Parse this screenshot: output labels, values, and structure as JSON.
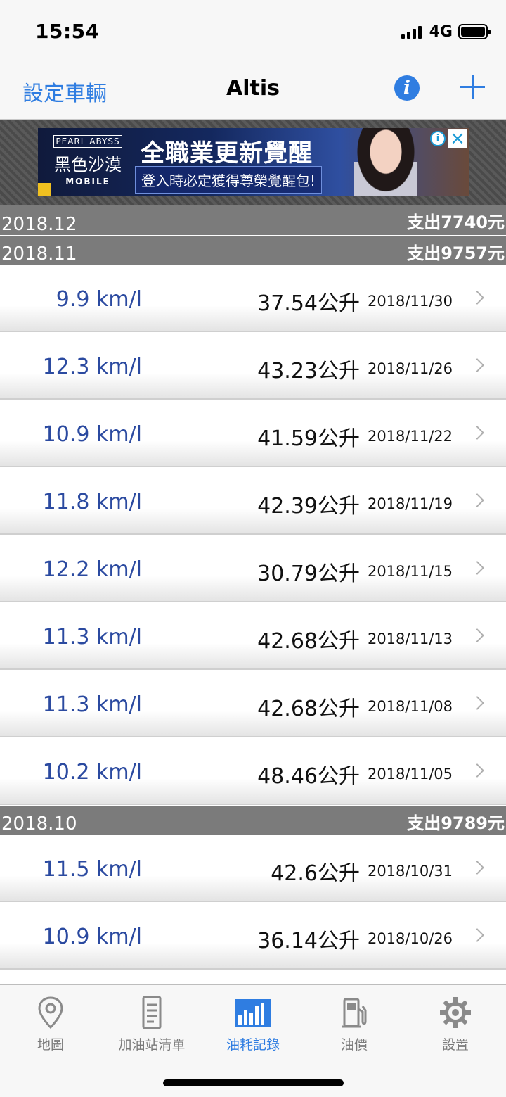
{
  "status_bar": {
    "time": "15:54",
    "network": "4G"
  },
  "nav": {
    "left_label": "設定車輛",
    "title": "Altis",
    "info_icon": "i"
  },
  "ad": {
    "brand": "PEARL ABYSS",
    "game": "黑色沙漠",
    "platform": "MOBILE",
    "headline": "全職業更新覺醒",
    "subline": "登入時必定獲得尊榮覺醒包!",
    "info_icon": "i",
    "close_icon": "×"
  },
  "months": [
    {
      "label": "2018.12",
      "total": "支出7740元",
      "entries": []
    },
    {
      "label": "2018.11",
      "total": "支出9757元",
      "entries": [
        {
          "efficiency": "9.9 km/l",
          "volume": "37.54公升",
          "date": "2018/11/30"
        },
        {
          "efficiency": "12.3 km/l",
          "volume": "43.23公升",
          "date": "2018/11/26"
        },
        {
          "efficiency": "10.9 km/l",
          "volume": "41.59公升",
          "date": "2018/11/22"
        },
        {
          "efficiency": "11.8 km/l",
          "volume": "42.39公升",
          "date": "2018/11/19"
        },
        {
          "efficiency": "12.2 km/l",
          "volume": "30.79公升",
          "date": "2018/11/15"
        },
        {
          "efficiency": "11.3 km/l",
          "volume": "42.68公升",
          "date": "2018/11/13"
        },
        {
          "efficiency": "11.3 km/l",
          "volume": "42.68公升",
          "date": "2018/11/08"
        },
        {
          "efficiency": "10.2 km/l",
          "volume": "48.46公升",
          "date": "2018/11/05"
        }
      ]
    },
    {
      "label": "2018.10",
      "total": "支出9789元",
      "entries": [
        {
          "efficiency": "11.5 km/l",
          "volume": "42.6公升",
          "date": "2018/10/31"
        },
        {
          "efficiency": "10.9 km/l",
          "volume": "36.14公升",
          "date": "2018/10/26"
        },
        {
          "efficiency": "",
          "volume": "",
          "date": ""
        }
      ]
    }
  ],
  "tabs": [
    {
      "label": "地圖",
      "icon": "map-pin-icon",
      "active": false
    },
    {
      "label": "加油站清單",
      "icon": "list-document-icon",
      "active": false
    },
    {
      "label": "油耗記錄",
      "icon": "bar-chart-icon",
      "active": true
    },
    {
      "label": "油價",
      "icon": "fuel-pump-icon",
      "active": false
    },
    {
      "label": "設置",
      "icon": "gear-icon",
      "active": false
    }
  ],
  "colors": {
    "accent": "#2f7de1",
    "header_gray": "#7b7b7b",
    "efficiency_blue": "#2b4aa0",
    "tab_inactive": "#8a8a8a"
  }
}
